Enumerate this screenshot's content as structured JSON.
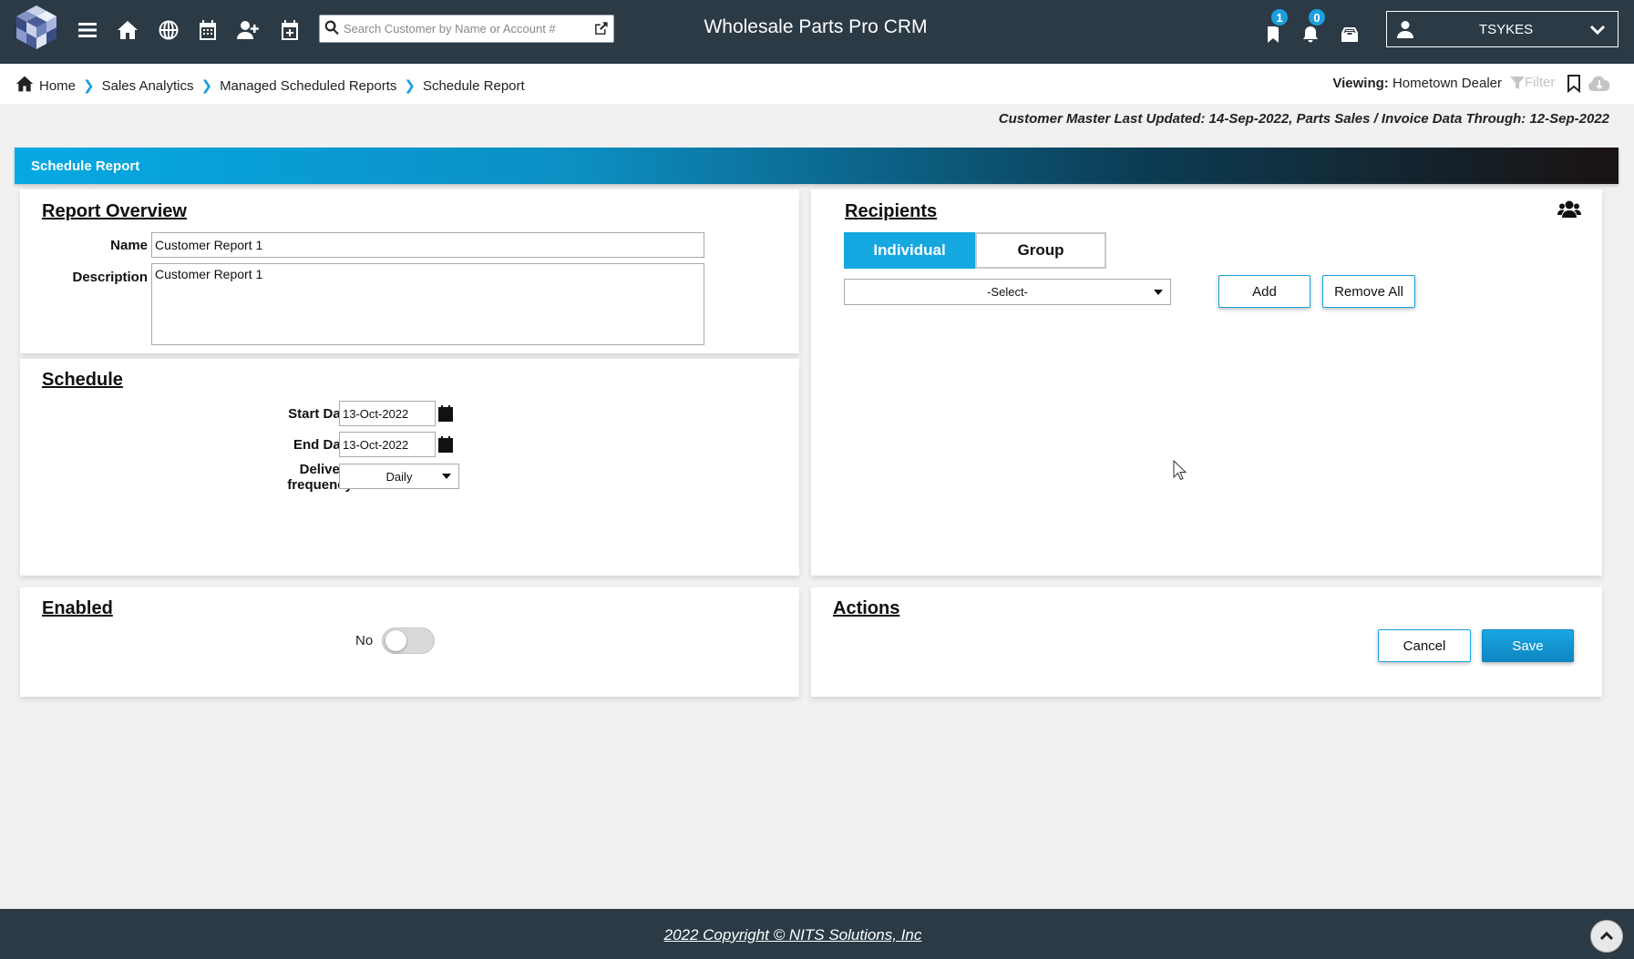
{
  "app": {
    "title": "Wholesale Parts Pro CRM"
  },
  "search": {
    "placeholder": "Search Customer by Name or Account #"
  },
  "notifications": {
    "bookmarks_count": "1",
    "alerts_count": "0"
  },
  "user": {
    "name": "TSYKES"
  },
  "breadcrumb": [
    "Home",
    "Sales Analytics",
    "Managed Scheduled Reports",
    "Schedule Report"
  ],
  "viewing": {
    "label": "Viewing:",
    "value": "Hometown Dealer"
  },
  "filter_label": "Filter",
  "last_updated": "Customer Master Last Updated: 14-Sep-2022, Parts Sales / Invoice Data Through: 12-Sep-2022",
  "page_header": "Schedule  Report",
  "overview": {
    "title": "Report Overview",
    "name_label": "Name",
    "name_value": "Customer Report 1",
    "description_label": "Description",
    "description_value": "Customer Report 1"
  },
  "schedule": {
    "title": "Schedule",
    "start_label": "Start Date",
    "start_value": "13-Oct-2022",
    "end_label": "End Date",
    "end_value": "13-Oct-2022",
    "frequency_label_1": "Delivery",
    "frequency_label_2": "frequency",
    "frequency_value": "Daily"
  },
  "recipients": {
    "title": "Recipients",
    "tab_individual": "Individual",
    "tab_group": "Group",
    "select_value": "-Select-",
    "add_label": "Add",
    "remove_all_label": "Remove All"
  },
  "enabled": {
    "title": "Enabled",
    "state_label": "No"
  },
  "actions": {
    "title": "Actions",
    "cancel_label": "Cancel",
    "save_label": "Save"
  },
  "footer": {
    "copyright": "2022 Copyright © NITS Solutions, Inc"
  },
  "colors": {
    "navbar": "#2b3a45",
    "accent": "#14a7e0",
    "badge": "#1aa1dd"
  },
  "icons": [
    "logo-icon",
    "menu-icon",
    "home-icon",
    "globe-icon",
    "calendar-icon",
    "add-user-icon",
    "calendar-add-icon",
    "search-icon",
    "external-link-icon",
    "bookmark-icon",
    "bell-icon",
    "inbox-icon",
    "user-icon",
    "chevron-down-icon",
    "filter-icon",
    "cloud-download-icon",
    "group-icon",
    "chevron-up-icon"
  ]
}
